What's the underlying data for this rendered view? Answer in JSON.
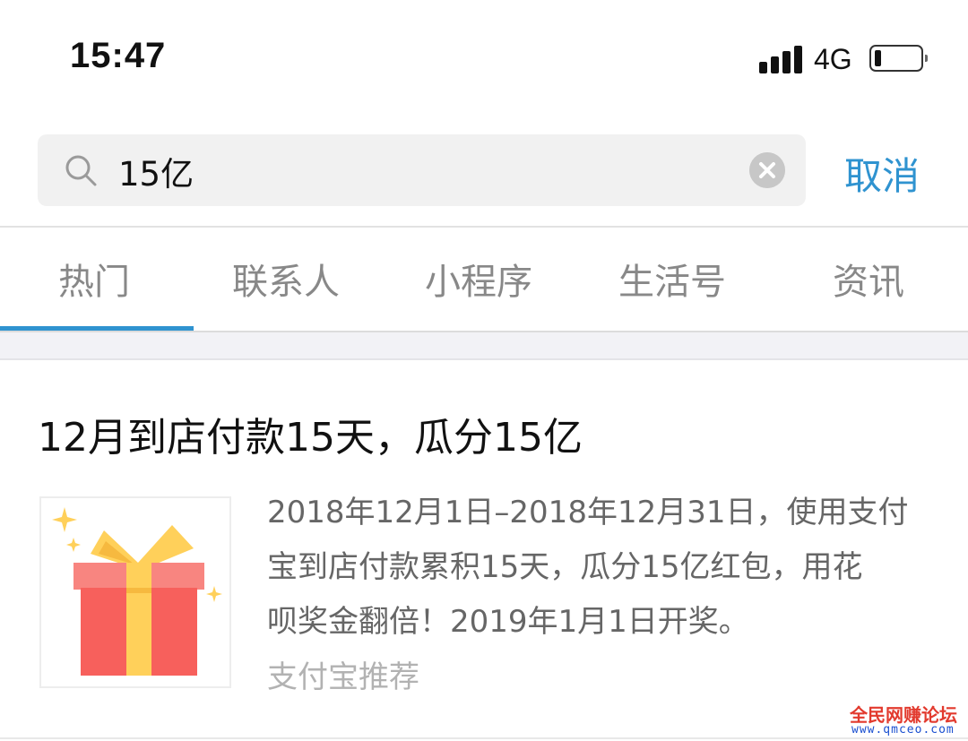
{
  "status_bar": {
    "time": "15:47",
    "network": "4G",
    "battery_level": 0.15
  },
  "search": {
    "query": "15亿",
    "cancel_label": "取消"
  },
  "tabs": [
    {
      "label": "热门",
      "active": true
    },
    {
      "label": "联系人",
      "active": false
    },
    {
      "label": "小程序",
      "active": false
    },
    {
      "label": "生活号",
      "active": false
    },
    {
      "label": "资讯",
      "active": false
    }
  ],
  "result": {
    "title": "12月到店付款15天，瓜分15亿",
    "description_lines": [
      "2018年12月1日–2018年12月31日，使用支付",
      "宝到店付款累积15天，瓜分15亿红包，用花",
      "呗奖金翻倍！2019年1月1日开奖。"
    ],
    "source": "支付宝推荐",
    "thumbnail_icon": "gift-box-icon"
  },
  "watermark": {
    "title": "全民网赚论坛",
    "url": "www.qmceo.com"
  },
  "colors": {
    "accent": "#2f93d0",
    "gift_red": "#f7605c",
    "gift_ribbon": "#ffd05a",
    "sparkle": "#ffd05a",
    "watermark_red": "#e23a2e",
    "watermark_blue": "#1a4fd0"
  }
}
